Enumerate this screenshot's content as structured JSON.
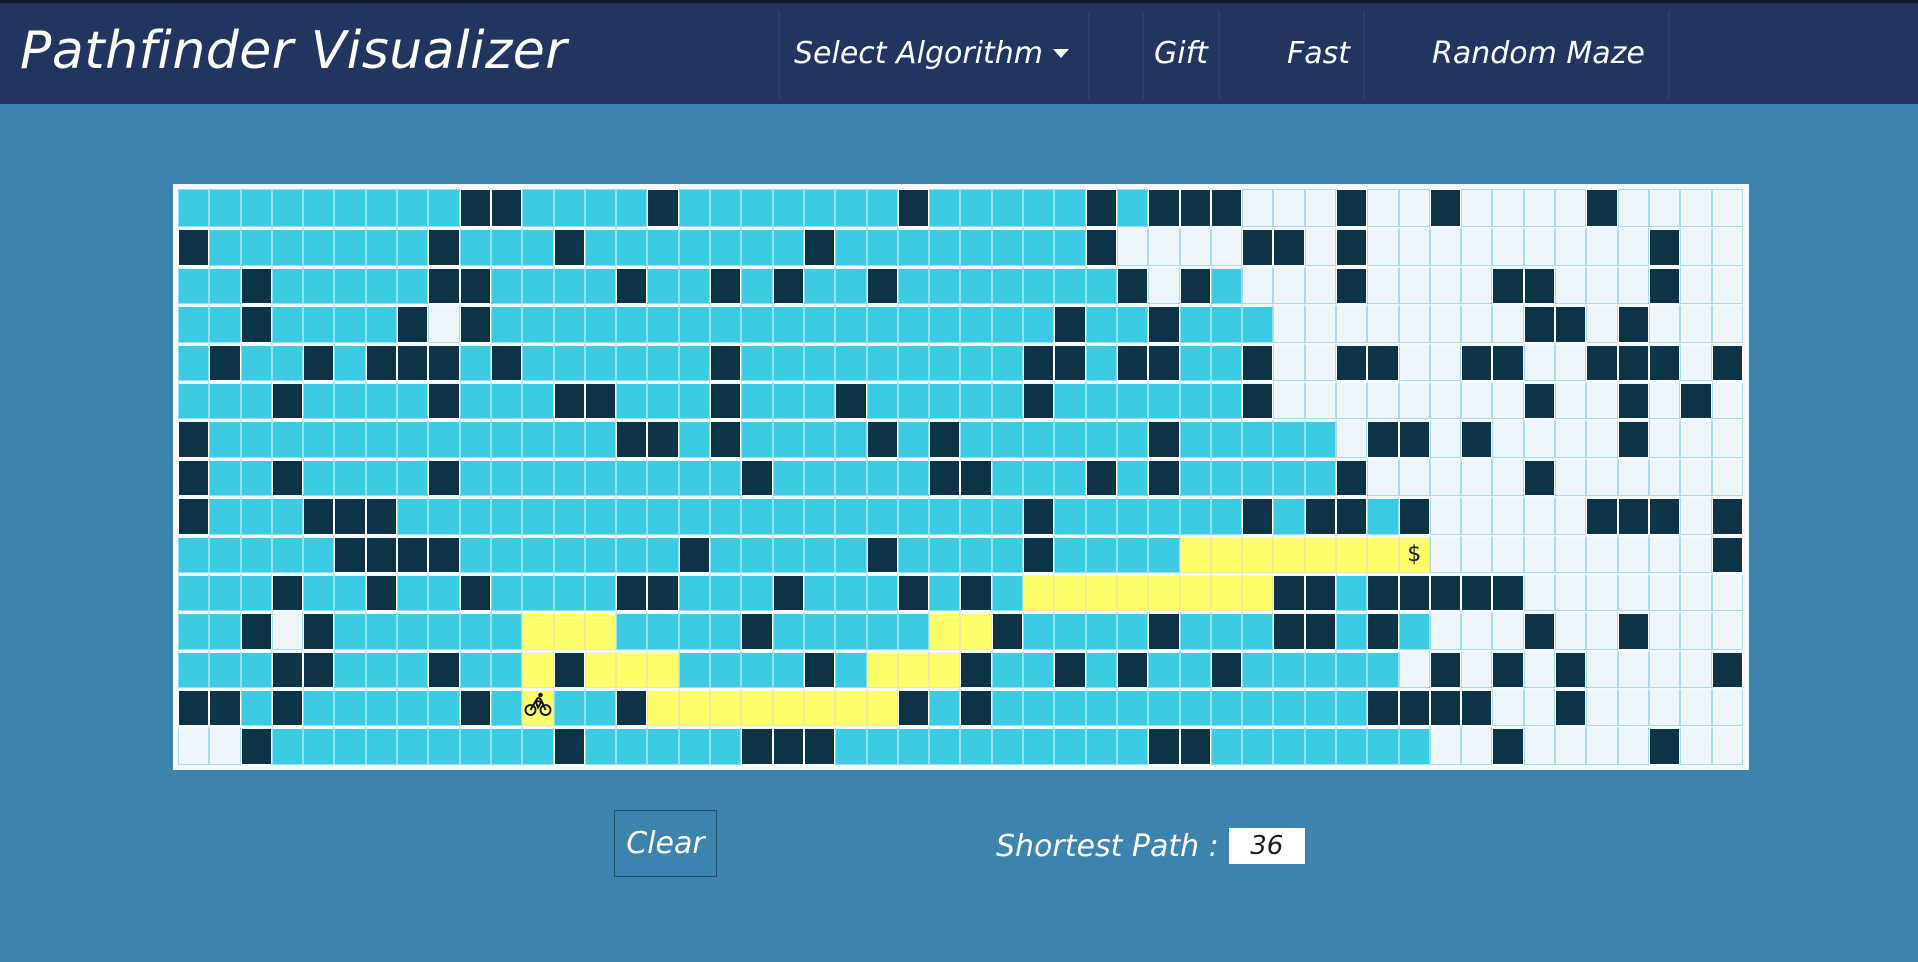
{
  "app": {
    "title": "Pathfinder Visualizer"
  },
  "nav": {
    "items": [
      {
        "label": "Select Algorithm",
        "has_caret": true
      },
      {
        "label": "Gift"
      },
      {
        "label": "Fast"
      },
      {
        "label": "Random Maze"
      }
    ]
  },
  "controls": {
    "clear_label": "Clear"
  },
  "result": {
    "label": "Shortest Path :",
    "value": "36"
  },
  "colors": {
    "topbar": "#223560",
    "background": "#3c83ad",
    "visited": "#3ccbe3",
    "wall": "#0d3346",
    "path": "#fefe6a",
    "unvisited": "#eef6fb"
  },
  "icons": {
    "start": "bicycle-icon",
    "target": "dollar-target-icon"
  },
  "grid": {
    "cols": 50,
    "legend": {
      "U": "unvisited",
      "V": "visited",
      "W": "wall",
      "P": "shortest-path",
      "S": "start-node",
      "T": "target-node"
    },
    "target_symbol": "$",
    "rows": [
      "VVVVVVVVVWWVVVVWVVVVVVVWVVVVVWVWWWUUUWUUWUUUUWUUUU",
      "WVVVVVVVWVVVWVVVVVVVWVVVVVVVVWUUUUWWUWUUUUUUUUUWUU",
      "VVWVVVVVWWVVVVWVVWVWVVWVVVVVVVWUWVUUUWUUUUWWUUUWUU",
      "VVWVVVVWUWVVVVVVVVVVVVVVVVVVWVVWVVVUUUUUUUUWWUWUUU",
      "VWVVWVWWWVWVVVVVVWVVVVVVVVVWWVWWVVWUUWWUUWWUUWWWUW",
      "VVVWVVVVWVVVWWVVVWVVVWVVVVVWVVVVVVWUUUUUUUUWUUWUWU",
      "WVVVVVVVVVVVVVWWVWVVVVWVWVVVVVVWVVVVVUWWUWUUUUWUUU",
      "WVVWVVVVWVVVVVVVVVWVVVVVWWVVVWVWVVVVVWUUUUUWUUUUUU",
      "WVVVWWWVVVVVVVVVVVVVVVVVVVVWVVVVVVWVWWVWUUUUUWWWUW",
      "VVVVVWWWWVVVVVVVWVVVVVWVVVVWVVVVPPPPPPPTUUUUUUUUUW",
      "VVVWVVWVVWVVVVWWVVVWVVVWVWVPPPPPPPPWWVWWWWWUUUUUUU",
      "VVWUWVVVVVVPPPVVVVWVVVVVPPWVVVVWVVVWWVWVUUUWUUWUUU",
      "VVVWWVVVWVVPWPPPVVVVWVPPPWVVWVWVVWVVVVVUWUWUWUUUUW",
      "WWVWVVVVVWVSVVWPPPPPPPPWVWVVVVVVVVVVVVWWWWUUWUUUUU",
      "UUWVVVVVVVVVWVVVVVWWWVVVVVVVVVVWWVVVVVVVUUWUUUUWUU"
    ]
  }
}
